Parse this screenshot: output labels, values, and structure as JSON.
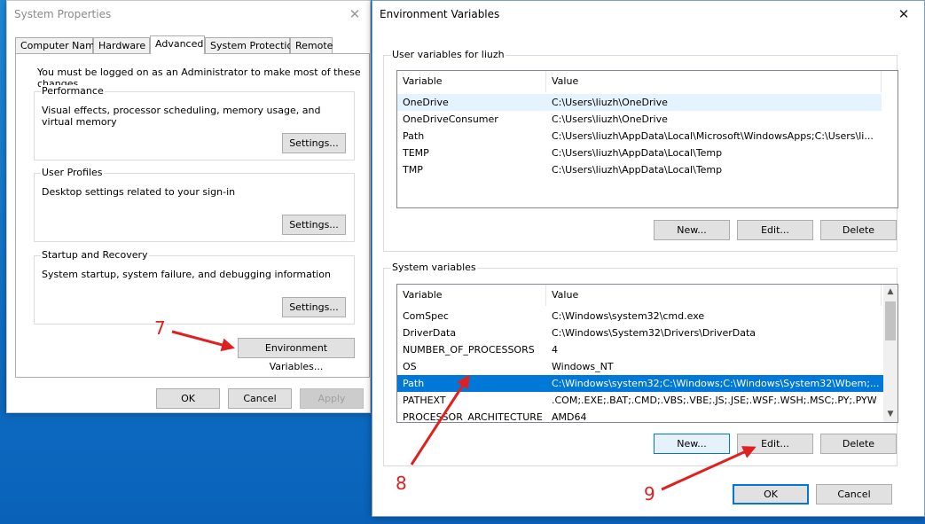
{
  "system_properties": {
    "title": "System Properties",
    "tabs": [
      "Computer Name",
      "Hardware",
      "Advanced",
      "System Protection",
      "Remote"
    ],
    "admin_note": "You must be logged on as an Administrator to make most of these changes.",
    "performance": {
      "title": "Performance",
      "description": "Visual effects, processor scheduling, memory usage, and virtual memory",
      "button": "Settings..."
    },
    "user_profiles": {
      "title": "User Profiles",
      "description": "Desktop settings related to your sign-in",
      "button": "Settings..."
    },
    "startup_recovery": {
      "title": "Startup and Recovery",
      "description": "System startup, system failure, and debugging information",
      "button": "Settings..."
    },
    "env_button": "Environment Variables...",
    "ok": "OK",
    "cancel": "Cancel",
    "apply": "Apply"
  },
  "env_vars": {
    "title": "Environment Variables",
    "user_section_title": "User variables for liuzh",
    "columns": [
      "Variable",
      "Value"
    ],
    "user_vars": [
      {
        "name": "OneDrive",
        "value": "C:\\Users\\liuzh\\OneDrive"
      },
      {
        "name": "OneDriveConsumer",
        "value": "C:\\Users\\liuzh\\OneDrive"
      },
      {
        "name": "Path",
        "value": "C:\\Users\\liuzh\\AppData\\Local\\Microsoft\\WindowsApps;C:\\Users\\li..."
      },
      {
        "name": "TEMP",
        "value": "C:\\Users\\liuzh\\AppData\\Local\\Temp"
      },
      {
        "name": "TMP",
        "value": "C:\\Users\\liuzh\\AppData\\Local\\Temp"
      }
    ],
    "user_buttons": {
      "new": "New...",
      "edit": "Edit...",
      "delete": "Delete"
    },
    "system_section_title": "System variables",
    "system_vars": [
      {
        "name": "ComSpec",
        "value": "C:\\Windows\\system32\\cmd.exe"
      },
      {
        "name": "DriverData",
        "value": "C:\\Windows\\System32\\Drivers\\DriverData"
      },
      {
        "name": "NUMBER_OF_PROCESSORS",
        "value": "4"
      },
      {
        "name": "OS",
        "value": "Windows_NT"
      },
      {
        "name": "Path",
        "value": "C:\\Windows\\system32;C:\\Windows;C:\\Windows\\System32\\Wbem;..."
      },
      {
        "name": "PATHEXT",
        "value": ".COM;.EXE;.BAT;.CMD;.VBS;.VBE;.JS;.JSE;.WSF;.WSH;.MSC;.PY;.PYW"
      },
      {
        "name": "PROCESSOR_ARCHITECTURE",
        "value": "AMD64"
      }
    ],
    "selected_system_var": "Path",
    "system_buttons": {
      "new": "New...",
      "edit": "Edit...",
      "delete": "Delete"
    },
    "ok": "OK",
    "cancel": "Cancel"
  },
  "annotations": {
    "step7": "7",
    "step8": "8",
    "step9": "9",
    "color": "#e02020"
  },
  "icons": {
    "close": "close-icon",
    "scroll_up": "chevron-up-icon",
    "scroll_down": "chevron-down-icon"
  }
}
